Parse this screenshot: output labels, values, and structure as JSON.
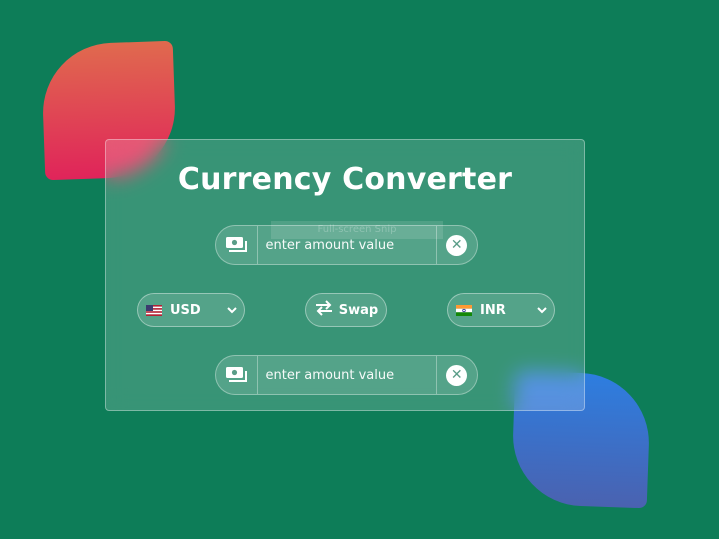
{
  "app": {
    "title": "Currency Converter"
  },
  "overlay": {
    "hint": "Full-screen Snip"
  },
  "from_amount": {
    "placeholder": "enter amount value",
    "value": ""
  },
  "to_amount": {
    "placeholder": "enter amount value",
    "value": ""
  },
  "from_currency": {
    "code": "USD",
    "flag": "us-flag-icon"
  },
  "to_currency": {
    "code": "INR",
    "flag": "in-flag-icon"
  },
  "swap": {
    "label": "Swap",
    "icon": "swap-arrows-icon"
  },
  "colors": {
    "background": "#0d7d58",
    "card": "rgba(255,255,255,0.18)",
    "accent_red": "#e0245a",
    "accent_blue": "#2d7ee0"
  }
}
